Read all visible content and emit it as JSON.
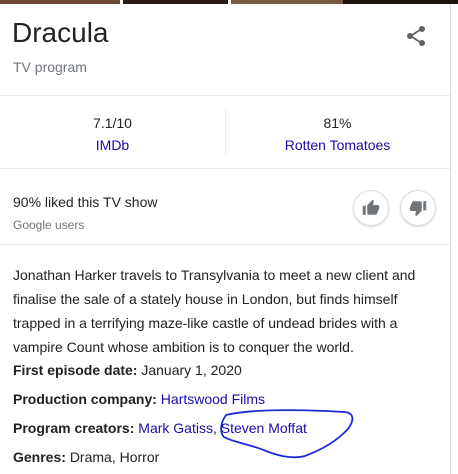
{
  "colors": {
    "link": "#1a0dab",
    "muted": "#70757a",
    "text": "#222222",
    "annotation": "#1f2bd6",
    "top_strip": [
      "#6e4a36",
      "#2a1c14",
      "#7a5a44",
      "#1d140e",
      "#8b6a52",
      "#3a2a20"
    ]
  },
  "header": {
    "title": "Dracula",
    "subtitle": "TV program",
    "share_icon": "share-icon"
  },
  "ratings": [
    {
      "value": "7.1/10",
      "source": "IMDb"
    },
    {
      "value": "81%",
      "source": "Rotten Tomatoes"
    }
  ],
  "audience": {
    "liked_text": "90% liked this TV show",
    "source": "Google users",
    "like_icon": "thumbs-up-icon",
    "dislike_icon": "thumbs-down-icon"
  },
  "description": "Jonathan Harker travels to Transylvania to meet a new client and finalise the sale of a stately house in London, but finds himself trapped in a terrifying maze-like castle of undead brides with a vampire Count whose ambition is to conquer the world.",
  "facts": {
    "first_episode": {
      "label": "First episode date:",
      "value": "January 1, 2020"
    },
    "production": {
      "label": "Production company:",
      "value": "Hartswood Films"
    },
    "creators": {
      "label": "Program creators:",
      "value1": "Mark Gatiss",
      "sep": ", ",
      "value2": "Steven Moffat"
    },
    "genres": {
      "label": "Genres:",
      "value": "Drama, Horror"
    }
  }
}
